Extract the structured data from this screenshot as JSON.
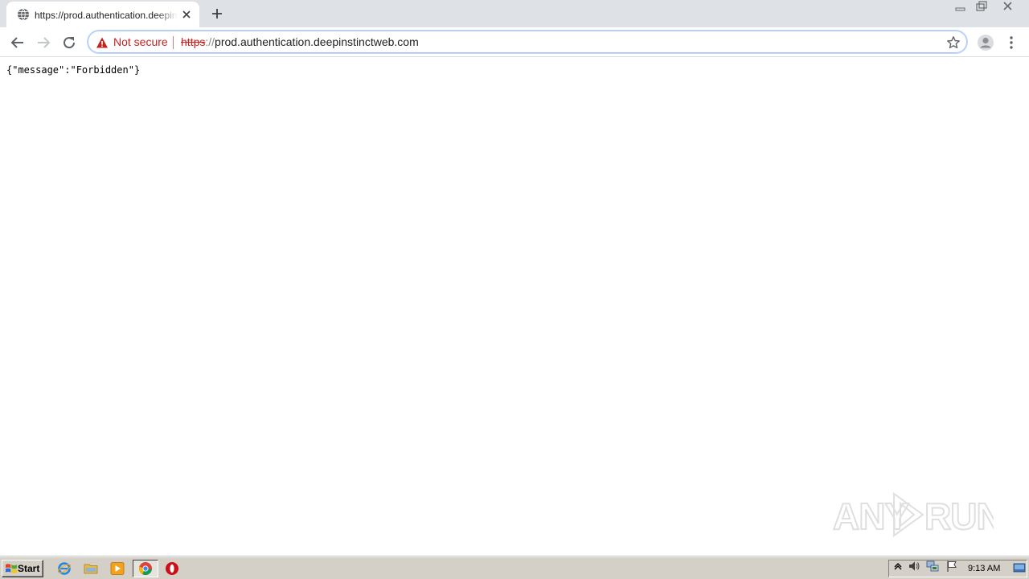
{
  "browser": {
    "tab": {
      "title": "https://prod.authentication.deepinstinctweb.com",
      "favicon": "globe-icon",
      "close": "close-icon"
    },
    "new_tab": "plus-icon",
    "window_controls": [
      "minimize-icon",
      "restore-icon",
      "close-icon"
    ],
    "toolbar": {
      "back": "arrow-left-icon",
      "forward": "arrow-right-icon",
      "reload": "reload-icon",
      "security_label": "Not secure",
      "url_scheme": "https",
      "url_separator": "://",
      "url_host": "prod.authentication.deepinstinctweb.com",
      "bookmark": "star-icon",
      "profile": "profile-icon",
      "menu": "kebab-menu-icon"
    }
  },
  "page": {
    "body_text": "{\"message\":\"Forbidden\"}"
  },
  "watermark": {
    "text_left": "ANY",
    "text_right": "RUN"
  },
  "taskbar": {
    "start_label": "Start",
    "pinned": [
      "internet-explorer-icon",
      "file-explorer-icon",
      "media-player-icon",
      "chrome-icon",
      "opera-icon"
    ],
    "tray_icons": [
      "show-hidden-icons-arrow",
      "volume-icon",
      "network-icon",
      "action-center-flag-icon"
    ],
    "clock": "9:13 AM"
  },
  "colors": {
    "tabstrip_bg": "#dee1e6",
    "not_secure_red": "#c5221f",
    "taskbar_bg": "#d4d0c8"
  }
}
